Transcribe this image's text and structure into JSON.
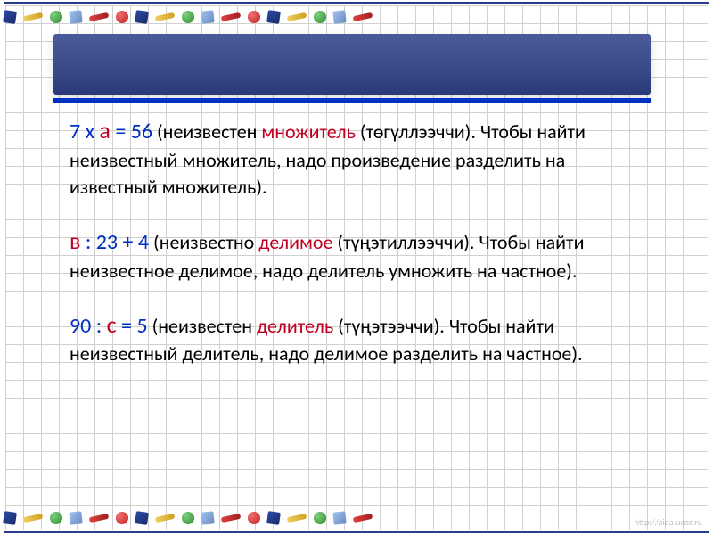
{
  "slide": {
    "para1": {
      "eq_pre": "7 х ",
      "eq_var": "а",
      "eq_post": " = 56",
      "intro_open": " (неизвестен ",
      "term": "множитель",
      "term_trans": " (төгүллээччи)",
      "close_period": ". ",
      "body": "Чтобы найти неизвестный множитель, надо произведение разделить на известный множитель)."
    },
    "para2": {
      "eq_var": "в",
      "eq_post": " : 23 + 4",
      "intro_open": " (неизвестно ",
      "term": "делимое",
      "term_trans": " (түңэтиллээччи)",
      "close_period": ". ",
      "body": "Чтобы найти неизвестное делимое, надо делитель умножить на частное)."
    },
    "para3": {
      "eq_pre": "90 : ",
      "eq_var": "с",
      "eq_post": " = 5",
      "intro_open": " (неизвестен ",
      "term": "делитель",
      "term_trans": " (түңэтээччи)",
      "close_period": ". ",
      "body": "Чтобы найти неизвестный делитель, надо делимое разделить на частное)."
    }
  },
  "watermark": "http://aida.ucoz.ru"
}
